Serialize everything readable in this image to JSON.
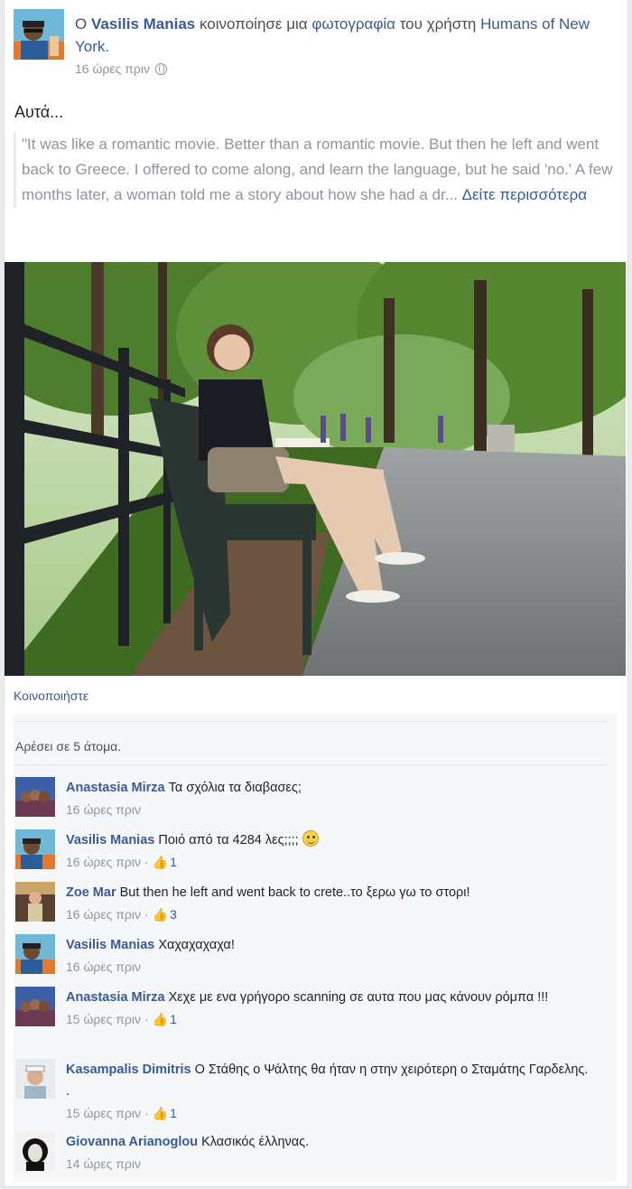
{
  "post": {
    "story": {
      "prefix": "Ο",
      "actor": "Vasilis Manias",
      "action": "κοινοποίησε μια",
      "object_link": "φωτογραφία",
      "connector": "του χρήστη",
      "page_name": "Humans of New York."
    },
    "timestamp": "16 ώρες πριν",
    "privacy_icon": "globe-icon",
    "message": "Αυτά...",
    "quote": "\"It was like a romantic movie. Better than a romantic movie. But then he left and went back to Greece. I offered to come along, and learn the language, but he said 'no.' A few months later, a woman told me a story about how she had a dr...",
    "see_more": "Δείτε περισσότερα",
    "share_label": "Κοινοποιήστε",
    "likes_text": "Αρέσει σε 5 άτομα."
  },
  "comments": [
    {
      "author": "Anastasia Mirza",
      "text": "Τα σχόλια τα διαβασες;",
      "time": "16 ώρες πριν",
      "likes": ""
    },
    {
      "author": "Vasilis Manias",
      "text": "Ποιό από τα 4284 λες;;;;",
      "time": "16 ώρες πριν",
      "likes": "1",
      "emoji": "smiley-icon"
    },
    {
      "author": "Zoe Mar",
      "text": "But then he left and went back to crete..το ξερω γω το στορι!",
      "time": "16 ώρες πριν",
      "likes": "3"
    },
    {
      "author": "Vasilis Manias",
      "text": "Χαχαχαχαχα!",
      "time": "16 ώρες πριν",
      "likes": ""
    },
    {
      "author": "Anastasia Mirza",
      "text": "Χεχε με ενα γρήγορο scanning σε αυτα που μας κάνουν ρόμπα !!!",
      "time": "15 ώρες πριν",
      "likes": "1"
    },
    {
      "author": "Kasampalis Dimitris",
      "text": "Ο Στάθης ο Ψάλτης θα ήταν η στην χειρότερη ο Σταμάτης Γαρδελης. .",
      "time": "15 ώρες πριν",
      "likes": "1"
    },
    {
      "author": "Giovanna Arianoglou",
      "text": "Κλασικός έλληνας.",
      "time": "14 ώρες πριν",
      "likes": ""
    }
  ],
  "colors": {
    "link": "#3b5998",
    "meta": "#90949c",
    "quote": "#90949c"
  }
}
